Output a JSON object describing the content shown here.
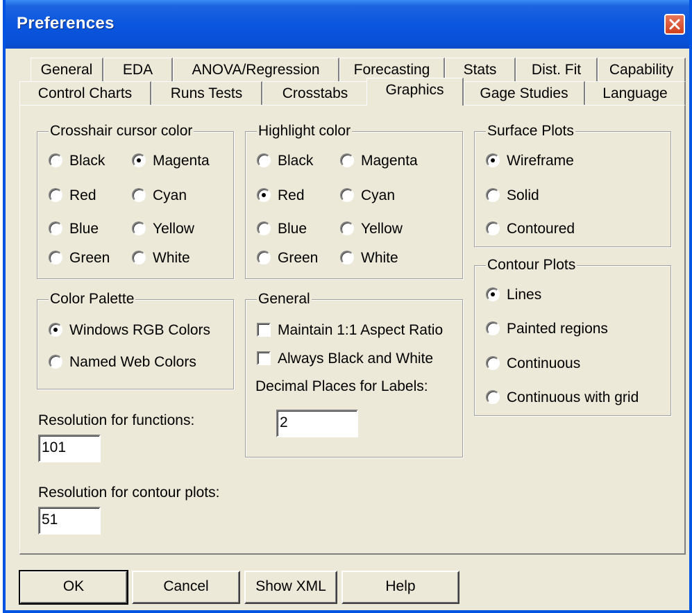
{
  "window": {
    "title": "Preferences"
  },
  "tabs": {
    "row1": [
      "General",
      "EDA",
      "ANOVA/Regression",
      "Forecasting",
      "Stats",
      "Dist. Fit",
      "Capability"
    ],
    "row2": [
      "Control Charts",
      "Runs Tests",
      "Crosstabs",
      "Graphics",
      "Gage Studies",
      "Language"
    ],
    "active": "Graphics"
  },
  "crosshair": {
    "title": "Crosshair cursor color",
    "options": [
      "Black",
      "Magenta",
      "Red",
      "Cyan",
      "Blue",
      "Yellow",
      "Green",
      "White"
    ],
    "selected": "Magenta"
  },
  "highlight": {
    "title": "Highlight color",
    "options": [
      "Black",
      "Magenta",
      "Red",
      "Cyan",
      "Blue",
      "Yellow",
      "Green",
      "White"
    ],
    "selected": "Red"
  },
  "surface_plots": {
    "title": "Surface Plots",
    "options": [
      "Wireframe",
      "Solid",
      "Contoured"
    ],
    "selected": "Wireframe"
  },
  "contour_plots": {
    "title": "Contour Plots",
    "options": [
      "Lines",
      "Painted regions",
      "Continuous",
      "Continuous with grid"
    ],
    "selected": "Lines"
  },
  "color_palette": {
    "title": "Color Palette",
    "options": [
      "Windows RGB Colors",
      "Named Web Colors"
    ],
    "selected": "Windows RGB Colors"
  },
  "general": {
    "title": "General",
    "aspect_ratio_label": "Maintain 1:1 Aspect Ratio",
    "aspect_ratio_checked": false,
    "black_white_label": "Always Black and White",
    "black_white_checked": false,
    "decimal_label": "Decimal Places for Labels:",
    "decimal_value": "2"
  },
  "resolution": {
    "functions_label": "Resolution for functions:",
    "functions_value": "101",
    "contour_label": "Resolution for contour plots:",
    "contour_value": "51"
  },
  "buttons": {
    "ok": "OK",
    "cancel": "Cancel",
    "show_xml": "Show XML",
    "help": "Help"
  },
  "colors": {
    "titlebar": "#0a56de",
    "dialog_bg": "#ece9d8",
    "close_button": "#d0401e"
  }
}
